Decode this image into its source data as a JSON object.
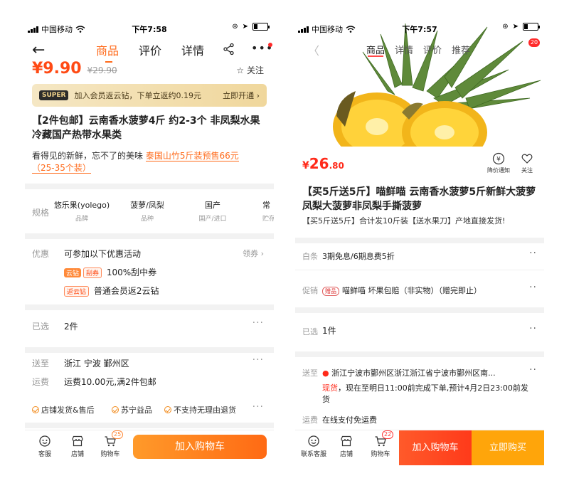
{
  "left": {
    "status": {
      "carrier": "中国移动",
      "time": "下午7:58"
    },
    "nav": {
      "tabs": [
        "商品",
        "评价",
        "详情"
      ],
      "active_tab": 0
    },
    "price": {
      "now": "¥9.90",
      "old": "¥29.90"
    },
    "follow_label": "关注",
    "super_bar": {
      "badge": "SUPER",
      "text": "加入会员返云钻，下单立返约0.19元",
      "button": "立即开通 ›"
    },
    "title": "【2件包邮】云南香水菠萝4斤 约2-3个 非凤梨水果冷藏国产热带水果类",
    "subtitle_prefix": "看得见的新鲜，忘不了的美味",
    "subtitle_link": "泰国山竹5斤装预售66元（25-35个装）",
    "spec": {
      "label": "规格",
      "items": [
        {
          "value": "悠乐果(yolego)",
          "key": "品牌"
        },
        {
          "value": "菠萝/凤梨",
          "key": "品种"
        },
        {
          "value": "国产",
          "key": "国产/进口"
        },
        {
          "value": "常",
          "key": "贮存"
        }
      ]
    },
    "promo": {
      "label": "优惠",
      "title": "可参加以下优惠活动",
      "coupon_label": "领券 ›",
      "line1_chips": [
        "云钻",
        "刮券"
      ],
      "line1_text": "100%刮中券",
      "line2_chip": "返云钻",
      "line2_text": "普通会员返2云钻"
    },
    "selected": {
      "label": "已选",
      "value": "2件"
    },
    "ship": {
      "label": "送至",
      "value": "浙江 宁波 鄞州区"
    },
    "fee": {
      "label": "运费",
      "value": "运费10.00元,满2件包邮"
    },
    "services": [
      "店铺发货&售后",
      "苏宁益品",
      "不支持无理由退货"
    ],
    "bottom": {
      "service_label": "客服",
      "shop_label": "店铺",
      "cart_label": "购物车",
      "cart_count": "25",
      "add_to_cart": "加入购物车"
    }
  },
  "right": {
    "status": {
      "carrier": "中国移动",
      "time": "下午7:57"
    },
    "nav": {
      "tabs": [
        "商品",
        "详情",
        "评价",
        "推荐"
      ],
      "active_tab": 0,
      "badge": "20"
    },
    "price": {
      "yen": "¥",
      "int": "26",
      "dec": ".80"
    },
    "price_notice_label": "降价通知",
    "follow_label": "关注",
    "title": "【买5斤送5斤】喵鲜喵 云南香水菠萝5斤新鲜大菠萝凤梨大菠萝非凤梨手撕菠萝",
    "subtitle": "【买5斤送5斤】合计发10斤装【送水果刀】产地直接发货!",
    "baitiao": {
      "label": "白条",
      "value": "3期免息/6期息费5折"
    },
    "promo": {
      "label": "促销",
      "chip": "赠品",
      "value": "喵鲜喵 坏果包赔（非实物）（赠完即止）"
    },
    "selected": {
      "label": "已选",
      "value": "1件"
    },
    "ship": {
      "label": "送至",
      "address": "浙江宁波市鄞州区浙江浙江省宁波市鄞州区南...",
      "stock": "现货",
      "eta": "，现在至明日11:00前完成下单,预计4月2日23:00前发货"
    },
    "fee": {
      "label": "运费",
      "value": "在线支付免运费"
    },
    "bottom": {
      "service_label": "联系客服",
      "shop_label": "店铺",
      "cart_label": "购物车",
      "cart_count": "22",
      "add_to_cart": "加入购物车",
      "buy_now": "立即购买"
    }
  },
  "colors": {
    "orange": "#ff6a1a",
    "red": "#ff2a1a",
    "gold": "#ffa50a"
  }
}
